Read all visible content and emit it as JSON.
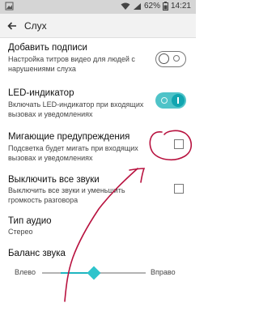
{
  "status_bar": {
    "battery_percent": "62%",
    "time": "14:21",
    "icons": [
      "image-icon",
      "wifi-icon",
      "signal-icon",
      "battery-icon"
    ]
  },
  "app_bar": {
    "title": "Слух",
    "back_icon": "arrow-left-icon"
  },
  "settings": [
    {
      "title": "Добавить подписи",
      "subtitle": "Настройка титров видео для людей с нарушениями слуха",
      "control": "toggle",
      "state": "off"
    },
    {
      "title": "LED-индикатор",
      "subtitle": "Включать LED-индикатор при входящих вызовах и уведомлениях",
      "control": "toggle",
      "state": "on"
    },
    {
      "title": "Мигающие предупреждения",
      "subtitle": "Подсветка будет мигать при входящих вызовах и уведомлениях",
      "control": "checkbox",
      "state": "unchecked"
    },
    {
      "title": "Выключить все звуки",
      "subtitle": "Выключить все звуки и уменьшить громкость разговора",
      "control": "checkbox",
      "state": "unchecked"
    },
    {
      "title": "Тип аудио",
      "subtitle": "Стерео",
      "control": "none"
    }
  ],
  "sound_balance": {
    "title": "Баланс звука",
    "left_label": "Влево",
    "right_label": "Вправо",
    "position": 0.5
  },
  "colors": {
    "accent": "#1fb5bf",
    "annotation": "#b8123f",
    "status_bar": "#d5d5d5",
    "app_bar": "#f2f2f2"
  }
}
